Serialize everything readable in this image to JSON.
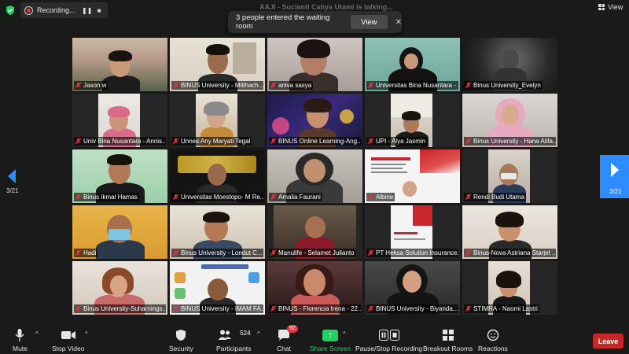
{
  "topbar": {
    "recording_label": "Recording...",
    "speaking_text": "AAJI - Sucianti Cahya Utami is talking...",
    "view_label": "View"
  },
  "toast": {
    "message": "3 people entered the waiting room",
    "button_label": "View"
  },
  "gallery": {
    "page_indicator": "3/21",
    "tiles": [
      "Jason w",
      "BINUS University - Milthach...",
      "aniva sasya",
      "Universitas Bina Nusantara - ...",
      "Binus University_Evelyn",
      "Univ Bina Nusantara - Annis...",
      "Unnes Any Maryati Tegal",
      "BINUS Online Learning-Ang...",
      "UPI - Alya Jasmin",
      "Binus University - Hana Alifa...",
      "Binus Ikmal Hamas",
      "Universitas Moestopo- M Re...",
      "Amalia Faurani",
      "Albine",
      "Rendi Budi Utama",
      "Hadi",
      "Binus University - Londut C...",
      "Manulife - Selamet Julianto",
      "PT Heksa Solution Insurance...",
      "Binus-Nova Astriana Starjet ...",
      "Binus University-Suharnings...",
      "BINUS University - IMAM FA...",
      "BINUS - Florencia Irena - 22...",
      "BINUS University - Biyanda...",
      "STIMRA - Naomi Lastri"
    ]
  },
  "toolbar": {
    "mute_label": "Mute",
    "video_label": "Stop Video",
    "security_label": "Security",
    "participants_label": "Participants",
    "participants_count": "524",
    "chat_label": "Chat",
    "chat_badge": "92",
    "share_label": "Share Screen",
    "record_label": "Pause/Stop Recording",
    "breakout_label": "Breakout Rooms",
    "reactions_label": "Reactions",
    "leave_label": "Leave"
  },
  "colors": {
    "accent_blue": "#2d8cff",
    "share_green": "#23d160",
    "leave_red": "#c62828",
    "muted_red": "#e8353e"
  }
}
